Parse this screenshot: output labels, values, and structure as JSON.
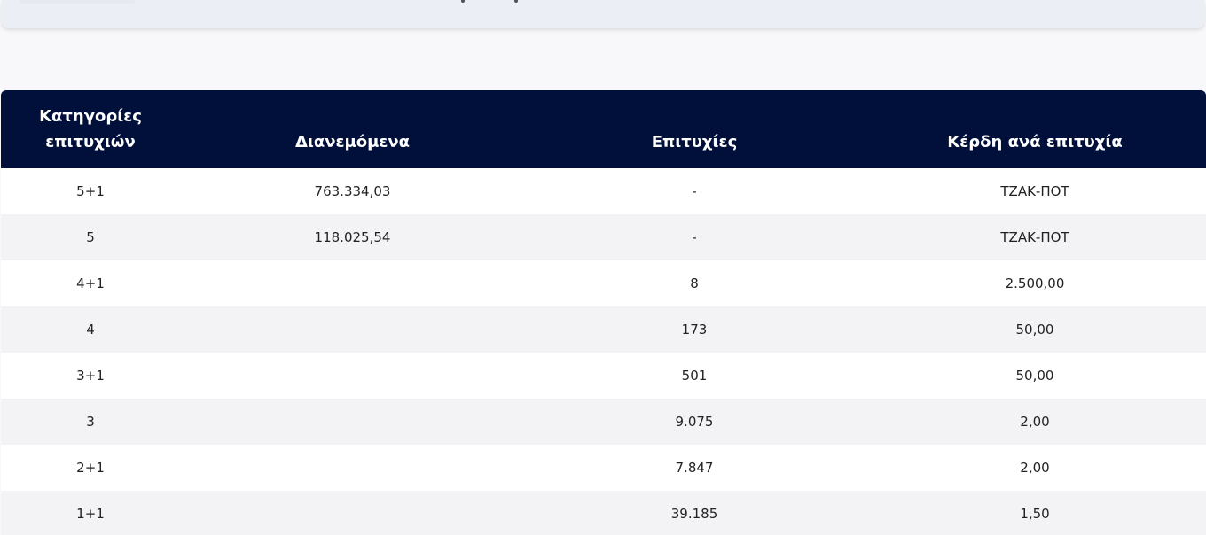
{
  "table": {
    "headers": {
      "category_line1": "Κατηγορίες",
      "category_line2": "επιτυχιών",
      "distributed": "Διανεμόμενα",
      "winners": "Επιτυχίες",
      "prize_per_winner": "Κέρδη ανά επιτυχία"
    },
    "rows": [
      {
        "category": "5+1",
        "distributed": "763.334,03",
        "winners": "-",
        "prize": "ΤΖΑΚ-ΠΟΤ"
      },
      {
        "category": "5",
        "distributed": "118.025,54",
        "winners": "-",
        "prize": "ΤΖΑΚ-ΠΟΤ"
      },
      {
        "category": "4+1",
        "distributed": "",
        "winners": "8",
        "prize": "2.500,00"
      },
      {
        "category": "4",
        "distributed": "",
        "winners": "173",
        "prize": "50,00"
      },
      {
        "category": "3+1",
        "distributed": "",
        "winners": "501",
        "prize": "50,00"
      },
      {
        "category": "3",
        "distributed": "",
        "winners": "9.075",
        "prize": "2,00"
      },
      {
        "category": "2+1",
        "distributed": "",
        "winners": "7.847",
        "prize": "2,00"
      },
      {
        "category": "1+1",
        "distributed": "",
        "winners": "39.185",
        "prize": "1,50"
      }
    ]
  },
  "colors": {
    "header_bg": "#01103a",
    "header_text": "#ffffff",
    "row_odd": "#ffffff",
    "row_even": "#f3f3f6",
    "page_bg": "#f8f8fb"
  }
}
